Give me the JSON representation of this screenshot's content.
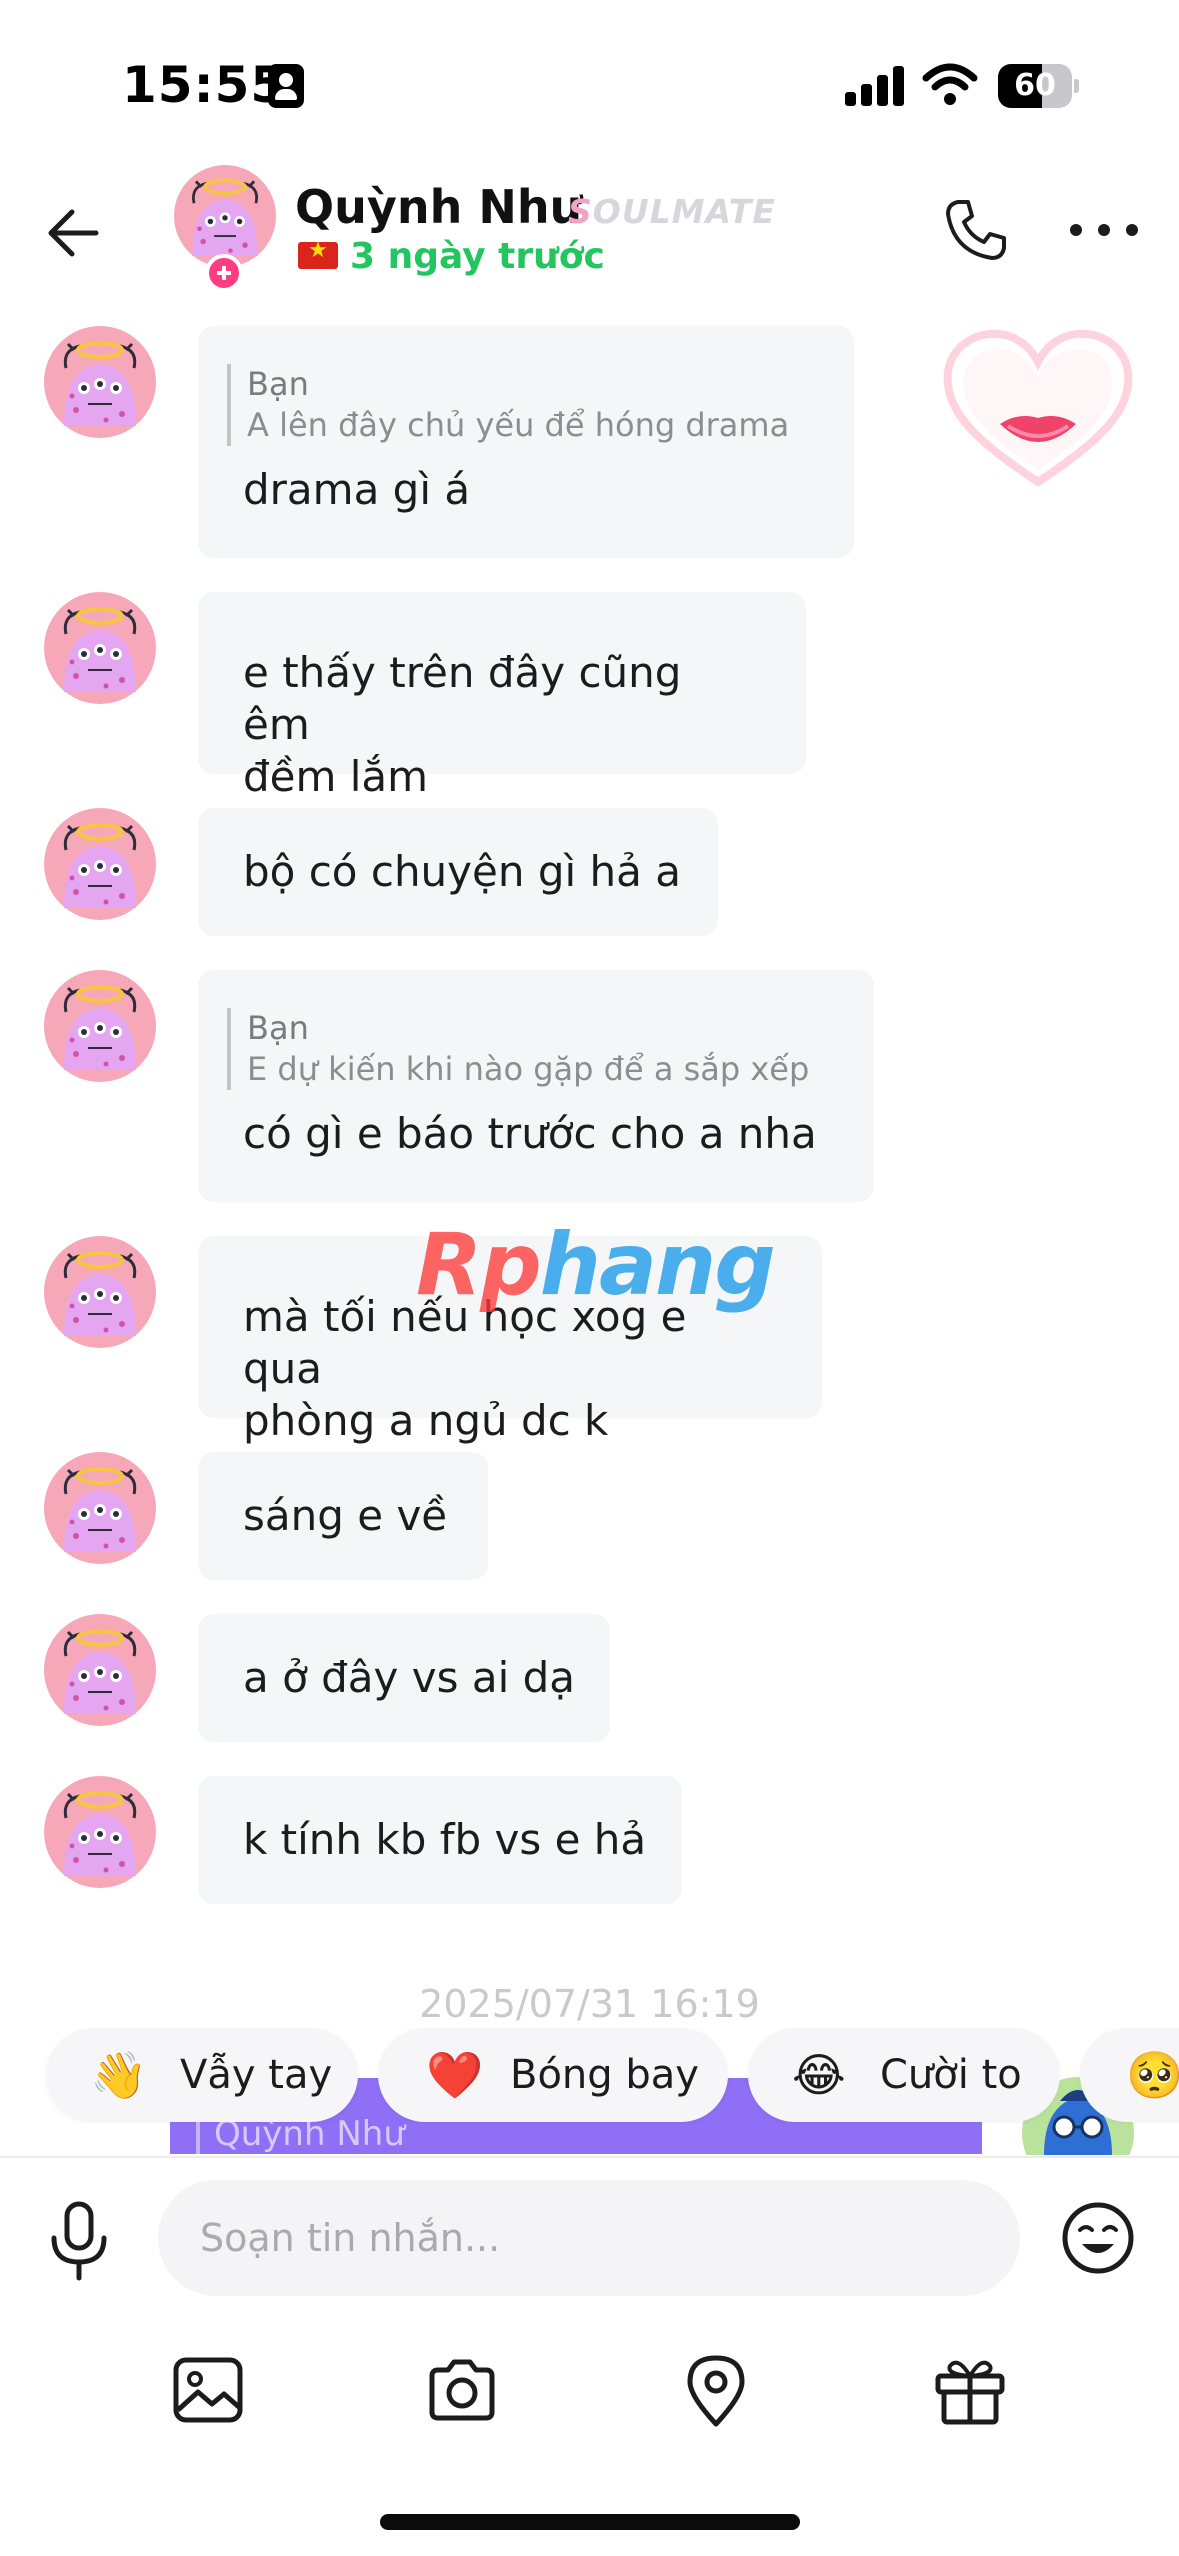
{
  "status_bar": {
    "time": "15:55",
    "battery": "60",
    "battery_level": 0.6
  },
  "header": {
    "contact_name": "Quỳnh Như",
    "badge": "SOULMATE",
    "badge_first_letter": "S",
    "badge_rest": "OULMATE",
    "last_seen": "3 ngày trước",
    "flag": "vietnam-flag"
  },
  "messages": [
    {
      "quote_name": "Bạn",
      "quote_text": "A lên đây chủ yếu để hóng drama",
      "text": "drama gì á"
    },
    {
      "text": "e thấy trên đây cũng êm\nđềm lắm"
    },
    {
      "text": "bộ có chuyện gì hả a"
    },
    {
      "quote_name": "Bạn",
      "quote_text": "E dự kiến khi nào gặp để a sắp xếp",
      "text": "có gì e báo trước cho a nha"
    },
    {
      "text": "mà tối nếu học xog e qua\nphòng a ngủ dc k"
    },
    {
      "text": "sáng e về"
    },
    {
      "text": "a ở đây vs ai dạ"
    },
    {
      "text": "k tính kb fb vs e hả"
    }
  ],
  "timestamp": "2025/07/31 16:19",
  "preview_quote": "Quỳnh Như",
  "watermark": {
    "part1": "Rp",
    "part2": "hang"
  },
  "quick_replies": [
    {
      "emoji": "👋",
      "label": "Vẫy tay"
    },
    {
      "emoji": "❤️",
      "label": "Bóng bay"
    },
    {
      "emoji": "😂",
      "label": "Cười to"
    },
    {
      "emoji": "🥺",
      "label": ""
    }
  ],
  "composer": {
    "placeholder": "Soạn tin nhắn..."
  },
  "toolbar": [
    "image-icon",
    "camera-icon",
    "location-icon",
    "gift-icon"
  ],
  "colors": {
    "accent_green": "#22c55e",
    "bubble_bg": "#f5f6f8",
    "preview_purple": "#8e6ff5",
    "avatar_pink": "#f7a8b8"
  }
}
